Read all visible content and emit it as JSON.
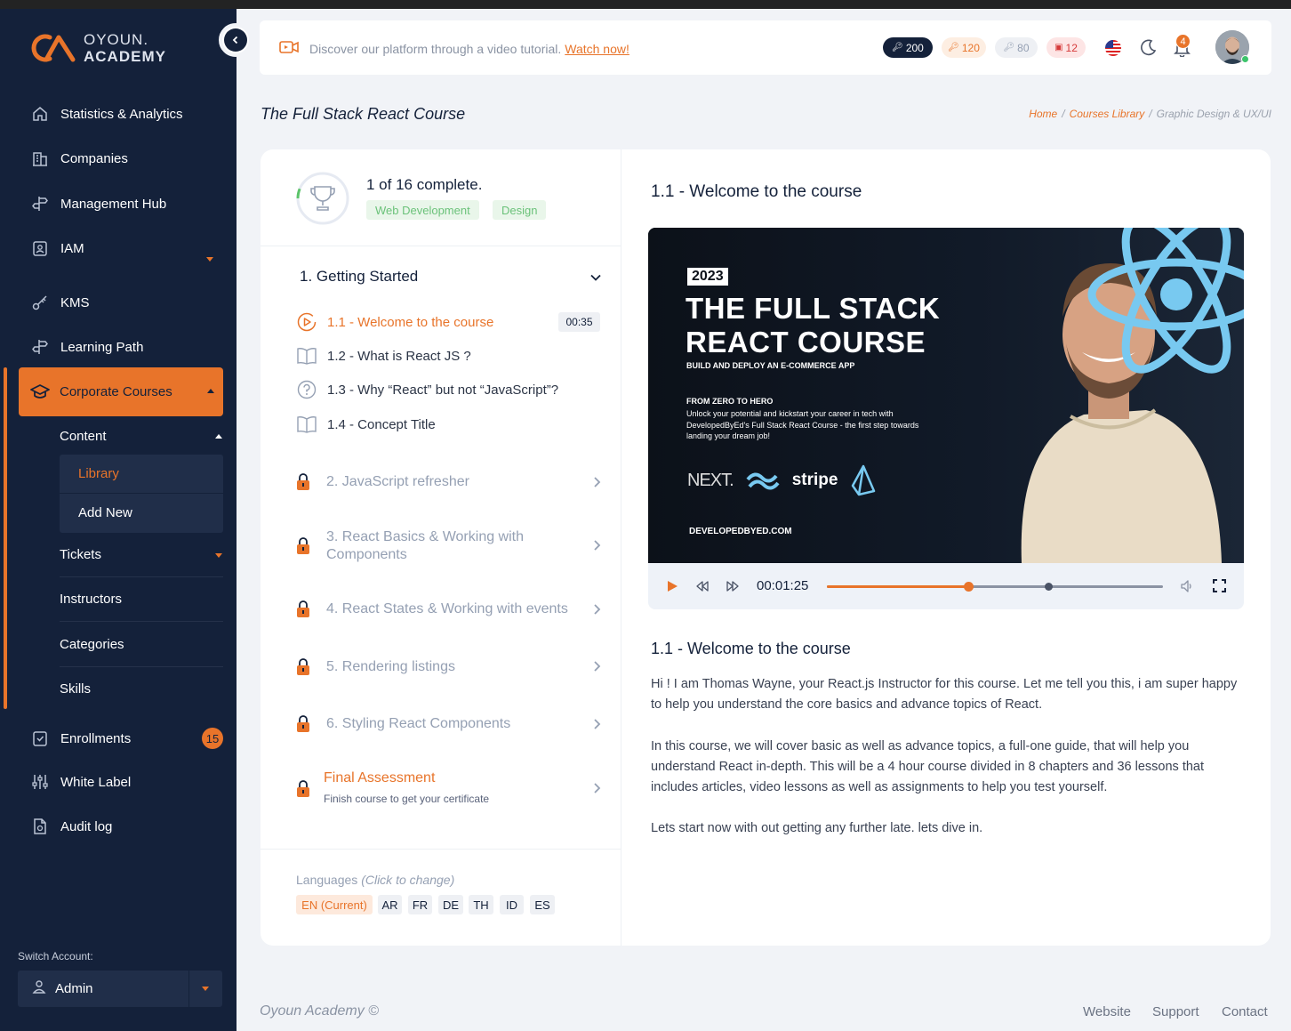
{
  "brand": {
    "line1": "OYOUN.",
    "line2": "ACADEMY"
  },
  "sidebar": {
    "items": [
      {
        "label": "Statistics & Analytics",
        "icon": "home-icon"
      },
      {
        "label": "Companies",
        "icon": "building-icon"
      },
      {
        "label": "Management Hub",
        "icon": "signpost-icon"
      },
      {
        "label": "IAM",
        "icon": "id-badge-icon"
      },
      {
        "label": "KMS",
        "icon": "key-icon"
      },
      {
        "label": "Learning Path",
        "icon": "signpost-icon"
      }
    ],
    "active": {
      "label": "Corporate Courses",
      "icon": "graduation-cap-icon"
    },
    "content_label": "Content",
    "library_label": "Library",
    "add_new_label": "Add New",
    "sub_items": [
      "Tickets",
      "Instructors",
      "Categories",
      "Skills"
    ],
    "enrollments_label": "Enrollments",
    "enrollments_badge": "15",
    "white_label": "White Label",
    "audit_log": "Audit log",
    "switch_account_label": "Switch Account:",
    "account_name": "Admin"
  },
  "topbar": {
    "promo_text": "Discover our platform through a video tutorial.",
    "promo_link": "Watch now!",
    "pills": [
      "200",
      "120",
      "80",
      "12"
    ],
    "notifications": "4"
  },
  "page": {
    "title": "The Full Stack React Course",
    "breadcrumb": [
      "Home",
      "Courses Library",
      "Graphic Design & UX/UI"
    ]
  },
  "course": {
    "complete_text": "1 of 16 complete.",
    "progress": 0.0625,
    "tags": [
      "Web Development",
      "Design"
    ],
    "section_title": "1. Getting Started",
    "lessons": [
      {
        "label": "1.1 - Welcome to the course",
        "duration": "00:35",
        "icon": "play-circle-icon"
      },
      {
        "label": "1.2 - What is React JS ?",
        "icon": "book-icon"
      },
      {
        "label": "1.3 - Why “React” but not “JavaScript”?",
        "icon": "question-circle-icon"
      },
      {
        "label": "1.4 - Concept Title",
        "icon": "book-icon"
      }
    ],
    "locked_sections": [
      "2. JavaScript refresher",
      "3. React Basics & Working with Components",
      "4. React States & Working with events",
      "5. Rendering listings",
      "6. Styling React Components"
    ],
    "final_title": "Final Assessment",
    "final_sub": "Finish course to get your certificate",
    "languages_label": "Languages",
    "languages_hint": "(Click to change)",
    "languages": [
      "EN (Current)",
      "AR",
      "FR",
      "DE",
      "TH",
      "ID",
      "ES"
    ]
  },
  "player": {
    "lesson_title": "1.1 - Welcome to the course",
    "thumb_year": "2023",
    "thumb_title_1": "THE FULL STACK",
    "thumb_title_2": "REACT COURSE",
    "thumb_subtitle": "BUILD AND DEPLOY AN E-COMMERCE APP",
    "thumb_hero": "FROM ZERO TO HERO",
    "thumb_desc": "Unlock your potential and kickstart your career in tech with DevelopedByEd's Full Stack React Course - the first step towards landing your dream job!",
    "thumb_logo_next": "NEXT.",
    "thumb_logo_stripe": "stripe",
    "thumb_url": "DEVELOPEDBYED.COM",
    "time": "00:01:25",
    "played": 0.42,
    "buffered": 0.66
  },
  "description": {
    "title": "1.1 - Welcome to the course",
    "p1": "Hi ! I am Thomas Wayne, your React.js Instructor for this course. Let me tell  you this, i am super happy to help you understand the core basics and advance topics of React.",
    "p2": "In this course, we will cover basic as well as advance topics, a full-one guide, that will help you understand React  in-depth. This will be a 4 hour course divided in 8 chapters and 36 lessons that includes articles, video lessons as well as assignments to help you test yourself.",
    "p3": "Lets start now with out getting any further late. lets dive in."
  },
  "footer": {
    "brand": "Oyoun Academy ©",
    "links": [
      "Website",
      "Support",
      "Contact"
    ]
  },
  "colors": {
    "accent": "#e8742a",
    "sidebar": "#14213a",
    "tag_green": "#6bc27a"
  }
}
